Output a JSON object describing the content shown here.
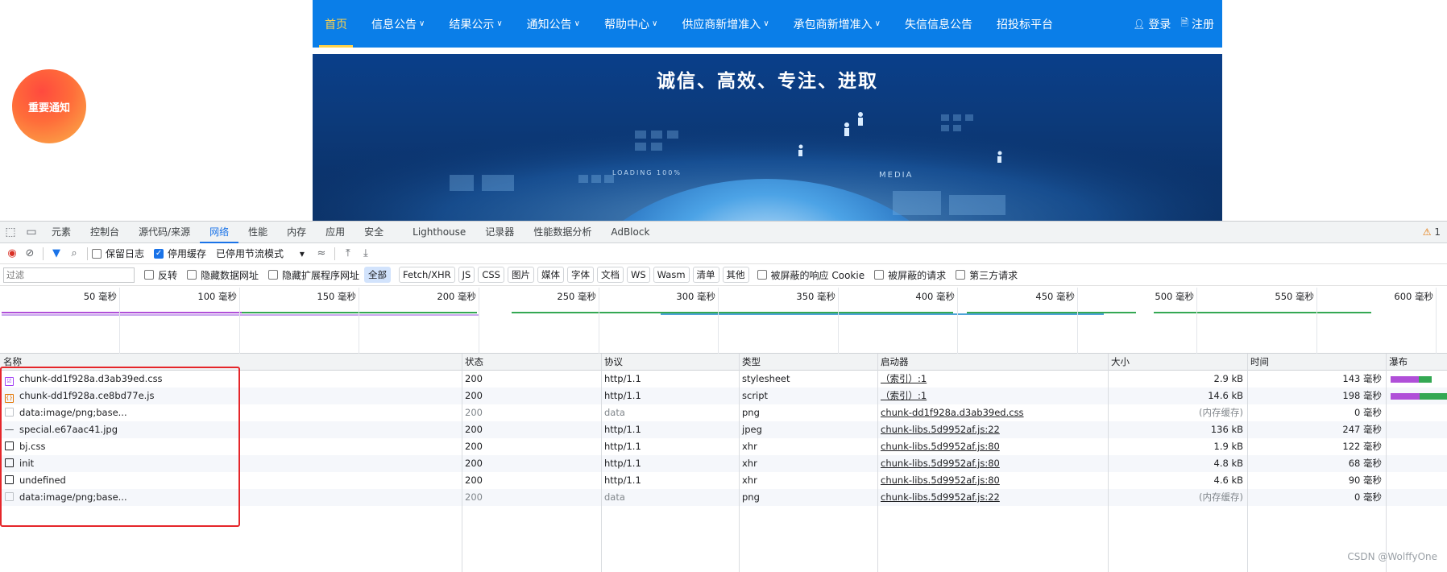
{
  "site": {
    "nav": [
      {
        "label": "首页",
        "active": true,
        "dropdown": false
      },
      {
        "label": "信息公告",
        "dropdown": true
      },
      {
        "label": "结果公示",
        "dropdown": true
      },
      {
        "label": "通知公告",
        "dropdown": true
      },
      {
        "label": "帮助中心",
        "dropdown": true
      },
      {
        "label": "供应商新增准入",
        "dropdown": true
      },
      {
        "label": "承包商新增准入",
        "dropdown": true
      },
      {
        "label": "失信信息公告",
        "dropdown": false
      },
      {
        "label": "招投标平台",
        "dropdown": false
      }
    ],
    "login": "登录",
    "register": "注册",
    "banner_title": "诚信、高效、专注、进取",
    "banner_text": "LOADING 100%",
    "banner_media": "MEDIA",
    "notice_button": "重要通知",
    "colors": {
      "nav_bg": "#0a7ee8",
      "active": "#ffd24a"
    }
  },
  "devtools": {
    "tabs": [
      "元素",
      "控制台",
      "源代码/来源",
      "网络",
      "性能",
      "内存",
      "应用",
      "安全",
      "Lighthouse",
      "记录器",
      "性能数据分析",
      "AdBlock"
    ],
    "active_tab": "网络",
    "warnings": "1",
    "toolbar": {
      "preserve_log": "保留日志",
      "disable_cache": "停用缓存",
      "throttling": "已停用节流模式"
    },
    "filter": {
      "placeholder": "过滤",
      "invert": "反转",
      "hide_data_urls": "隐藏数据网址",
      "hide_extension_urls": "隐藏扩展程序网址",
      "types": [
        "全部",
        "Fetch/XHR",
        "JS",
        "CSS",
        "图片",
        "媒体",
        "字体",
        "文档",
        "WS",
        "Wasm",
        "清单",
        "其他"
      ],
      "blocked_cookies": "被屏蔽的响应 Cookie",
      "blocked_requests": "被屏蔽的请求",
      "third_party": "第三方请求"
    },
    "overview_ticks": [
      "50 毫秒",
      "100 毫秒",
      "150 毫秒",
      "200 毫秒",
      "250 毫秒",
      "300 毫秒",
      "350 毫秒",
      "400 毫秒",
      "450 毫秒",
      "500 毫秒",
      "550 毫秒",
      "600 毫秒"
    ],
    "columns": [
      "名称",
      "状态",
      "协议",
      "类型",
      "启动器",
      "大小",
      "时间",
      "瀑布"
    ],
    "rows": [
      {
        "icon": "css",
        "name": "chunk-dd1f928a.d3ab39ed.css",
        "status": "200",
        "protocol": "http/1.1",
        "type": "stylesheet",
        "initiator": "（索引）:1",
        "size": "2.9 kB",
        "time": "143 毫秒",
        "grey": false
      },
      {
        "icon": "js",
        "name": "chunk-dd1f928a.ce8bd77e.js",
        "status": "200",
        "protocol": "http/1.1",
        "type": "script",
        "initiator": "（索引）:1",
        "size": "14.6 kB",
        "time": "198 毫秒",
        "grey": false
      },
      {
        "icon": "img",
        "name": "data:image/png;base...",
        "status": "200",
        "protocol": "data",
        "type": "png",
        "initiator": "chunk-dd1f928a.d3ab39ed.css",
        "size": "(内存缓存)",
        "time": "0 毫秒",
        "grey": true
      },
      {
        "icon": "line",
        "name": "special.e67aac41.jpg",
        "status": "200",
        "protocol": "http/1.1",
        "type": "jpeg",
        "initiator": "chunk-libs.5d9952af.js:22",
        "size": "136 kB",
        "time": "247 毫秒",
        "grey": false
      },
      {
        "icon": "doc",
        "name": "bj.css",
        "status": "200",
        "protocol": "http/1.1",
        "type": "xhr",
        "initiator": "chunk-libs.5d9952af.js:80",
        "size": "1.9 kB",
        "time": "122 毫秒",
        "grey": false
      },
      {
        "icon": "doc",
        "name": "init",
        "status": "200",
        "protocol": "http/1.1",
        "type": "xhr",
        "initiator": "chunk-libs.5d9952af.js:80",
        "size": "4.8 kB",
        "time": "68 毫秒",
        "grey": false
      },
      {
        "icon": "doc",
        "name": "undefined",
        "status": "200",
        "protocol": "http/1.1",
        "type": "xhr",
        "initiator": "chunk-libs.5d9952af.js:80",
        "size": "4.6 kB",
        "time": "90 毫秒",
        "grey": false
      },
      {
        "icon": "img",
        "name": "data:image/png;base...",
        "status": "200",
        "protocol": "data",
        "type": "png",
        "initiator": "chunk-libs.5d9952af.js:22",
        "size": "(内存缓存)",
        "time": "0 毫秒",
        "grey": true
      }
    ]
  },
  "watermark": "CSDN @WolffyOne"
}
